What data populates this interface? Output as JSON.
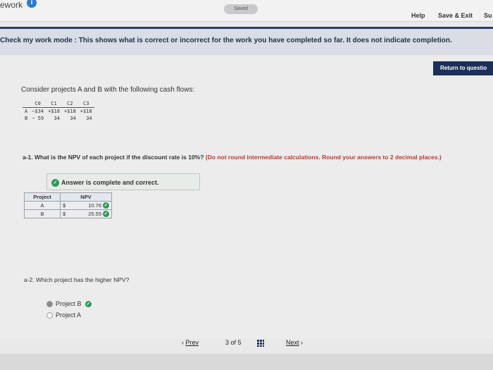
{
  "header": {
    "app_title": "ework",
    "saved_label": "Saved",
    "help_label": "Help",
    "save_exit_label": "Save & Exit",
    "submit_label": "Su"
  },
  "mode_banner": "Check my work mode : This shows what is correct or incorrect for the work you have completed so far. It does not indicate completion.",
  "return_button": "Return to questio",
  "intro_text": "Consider projects A and B with the following cash flows:",
  "cash_flows": {
    "headers": [
      "C0",
      "C1",
      "C2",
      "C3"
    ],
    "rows": [
      {
        "project": "A",
        "c0": "−$34",
        "c1": "+$18",
        "c2": "+$18",
        "c3": "+$18"
      },
      {
        "project": "B",
        "c0": "− 59",
        "c1": "34",
        "c2": "34",
        "c3": "34"
      }
    ]
  },
  "question_a1": {
    "prefix": "a-1. What is the NPV of each project if the discount rate is 10%?",
    "hint": "(Do not round intermediate calculations. Round your answers to 2 decimal places.)"
  },
  "answer_status": "Answer is complete and correct.",
  "npv_table": {
    "headers": [
      "Project",
      "NPV"
    ],
    "rows": [
      {
        "project": "A",
        "currency": "$",
        "value": "10.76"
      },
      {
        "project": "B",
        "currency": "$",
        "value": "25.55"
      }
    ]
  },
  "question_a2": "a-2. Which project has the higher NPV?",
  "options": [
    {
      "label": "Project B",
      "selected": true,
      "correct": true
    },
    {
      "label": "Project A",
      "selected": false,
      "correct": false
    }
  ],
  "pager": {
    "prev_label": "Prev",
    "position": "3",
    "of_label": "of",
    "total": "5",
    "next_label": "Next"
  },
  "colors": {
    "nav_accent": "#1b2f5a",
    "correct_green": "#2a9a5b",
    "info_blue": "#2b7bd3",
    "hint_red": "#c0392b"
  }
}
